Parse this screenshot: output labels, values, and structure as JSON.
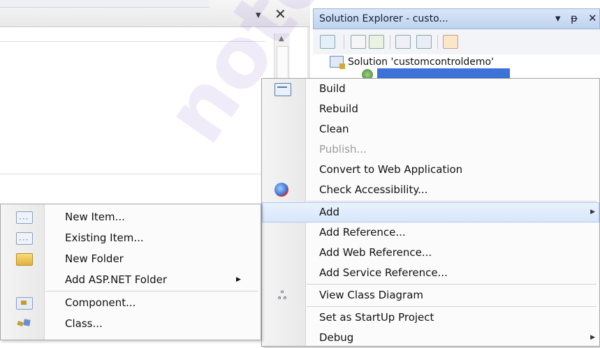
{
  "left_pane": {
    "dropdown_glyph": "▾",
    "close_glyph": "✕"
  },
  "solution_explorer": {
    "title": "Solution Explorer - custo...",
    "pin_glyph": "ᵽ",
    "dropdown_glyph": "▾",
    "close_glyph": "✕",
    "toolbar_icons": [
      "properties-icon",
      "show-all-files-icon",
      "refresh-icon",
      "view-code-icon",
      "view-designer-icon",
      "copy-website-icon"
    ],
    "tree": {
      "solution_label": "Solution 'customcontroldemo'",
      "project_selected": true
    }
  },
  "context_menu": {
    "items": [
      {
        "label": "Build",
        "icon": "build-icon"
      },
      {
        "label": "Rebuild"
      },
      {
        "label": "Clean"
      },
      {
        "label": "Publish...",
        "disabled": true
      },
      {
        "label": "Convert to Web Application"
      },
      {
        "label": "Check Accessibility...",
        "icon": "accessibility-icon"
      },
      {
        "label": "Add",
        "highlighted": true,
        "submenu": true
      },
      {
        "label": "Add Reference..."
      },
      {
        "label": "Add Web Reference..."
      },
      {
        "label": "Add Service Reference..."
      },
      {
        "label": "View Class Diagram",
        "icon": "class-diagram-icon"
      },
      {
        "label": "Set as StartUp Project"
      },
      {
        "label": "Debug",
        "submenu": true
      }
    ],
    "submenu_arrow": "▶"
  },
  "add_submenu": {
    "items": [
      {
        "label": "New Item...",
        "icon": "new-item-icon"
      },
      {
        "label": "Existing Item...",
        "icon": "existing-item-icon"
      },
      {
        "label": "New Folder",
        "icon": "folder-icon"
      },
      {
        "label": "Add ASP.NET Folder",
        "submenu": true
      },
      {
        "label": "Component...",
        "icon": "component-icon"
      },
      {
        "label": "Class...",
        "icon": "class-icon"
      }
    ],
    "submenu_arrow": "▶"
  },
  "watermark": {
    "text": "notes"
  },
  "colors": {
    "highlight": "#d7e6fb",
    "selection": "#3d73d8",
    "title_gradient": "#bfd3ee"
  }
}
